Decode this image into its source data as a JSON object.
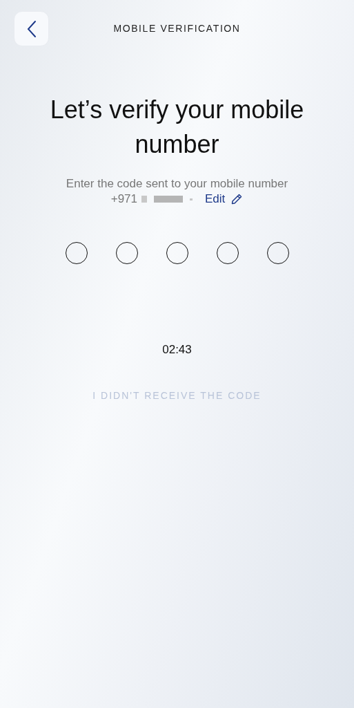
{
  "header": {
    "title": "MOBILE VERIFICATION"
  },
  "heading": "Let’s verify your mobile number",
  "instructions": "Enter the code sent to your mobile number",
  "phone": {
    "prefix": "+971",
    "masked": true,
    "edit_label": "Edit"
  },
  "code_slots": [
    {
      "filled": false
    },
    {
      "filled": false
    },
    {
      "filled": false
    },
    {
      "filled": false
    },
    {
      "filled": false
    }
  ],
  "timer": "02:43",
  "resend": {
    "label": "I DIDN'T RECEIVE THE CODE",
    "disabled": true
  }
}
